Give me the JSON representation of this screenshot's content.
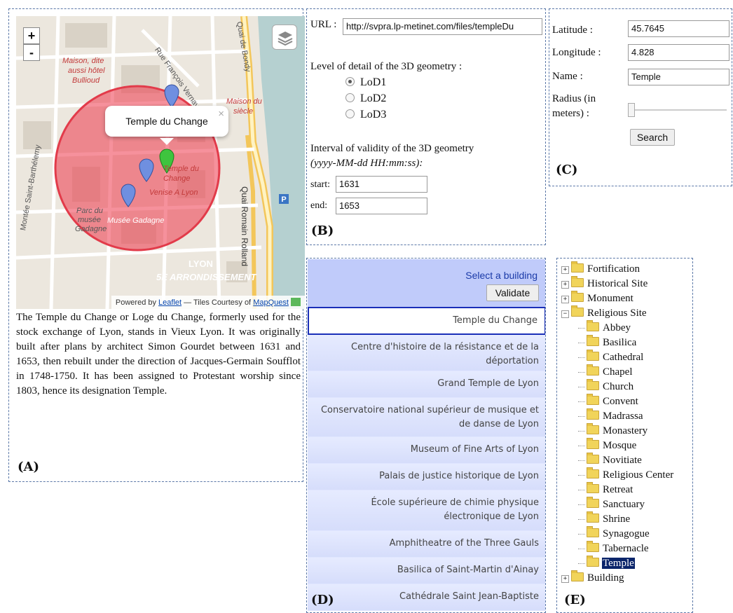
{
  "panelA": {
    "label": "(A)",
    "map": {
      "zoom_in": "+",
      "zoom_out": "-",
      "popup_text": "Temple du Change",
      "popup_close": "×",
      "attribution_prefix": "Powered by",
      "attribution_leaflet": "Leaflet",
      "attribution_mid": "— Tiles Courtesy of",
      "attribution_mapquest": "MapQuest",
      "street_labels": [
        "Maison, dite",
        "aussi hôtel",
        "Bullioud",
        "Rue François Vernay",
        "Quai de Bondy",
        "Maison du",
        "siècle",
        "Temple du",
        "Change",
        "Venise A Lyon",
        "Parc du",
        "musée",
        "Gadagne",
        "Musée Gadagne",
        "Quai Romain Rolland",
        "LYON",
        "5E ARRONDISSEMENT",
        "Montée Saint-Barthélemy",
        "P"
      ],
      "circle_color": "#e0505a",
      "marker_colors": [
        "#6f8fe0",
        "#3ec43e"
      ]
    },
    "description": "The Temple du Change or Loge du Change, formerly used for the stock exchange of Lyon, stands in Vieux Lyon. It was originally built after plans by architect Simon Gourdet between 1631 and 1653, then rebuilt under the direction of Jacques-Germain Soufflot in 1748-1750. It has been assigned to Protestant worship since 1803, hence its designation Temple."
  },
  "panelB": {
    "label": "(B)",
    "url_label": "URL :",
    "url_value": "http://svpra.lp-metinet.com/files/templeDu",
    "lod_label": "Level of detail of the 3D geometry :",
    "lod_options": [
      "LoD1",
      "LoD2",
      "LoD3"
    ],
    "lod_selected": "LoD1",
    "interval_label": "Interval of validity of the 3D geometry",
    "interval_format": "(yyyy-MM-dd HH:mm:ss):",
    "start_label": "start:",
    "start_value": "1631",
    "end_label": "end:",
    "end_value": "1653"
  },
  "panelC": {
    "label": "(C)",
    "latitude_label": "Latitude :",
    "latitude_value": "45.7645",
    "longitude_label": "Longitude :",
    "longitude_value": "4.828",
    "name_label": "Name :",
    "name_value": "Temple",
    "radius_label_1": "Radius (in",
    "radius_label_2": "meters) :",
    "radius_level": 0,
    "search_button": "Search"
  },
  "panelD": {
    "label": "(D)",
    "select_label": "Select a building",
    "validate_button": "Validate",
    "buildings": [
      "Temple du Change",
      "Centre d'histoire de la résistance et de la déportation",
      "Grand Temple de Lyon",
      "Conservatoire national supérieur de musique et de danse de Lyon",
      "Museum of Fine Arts of Lyon",
      "Palais de justice historique de Lyon",
      "École supérieure de chimie physique électronique de Lyon",
      "Amphitheatre of the Three Gauls",
      "Basilica of Saint-Martin d'Ainay",
      "Cathédrale Saint Jean-Baptiste"
    ],
    "selected_index": 0
  },
  "panelE": {
    "label": "(E)",
    "top_nodes": [
      {
        "label": "Fortification",
        "toggle": "+"
      },
      {
        "label": "Historical Site",
        "toggle": "+"
      },
      {
        "label": "Monument",
        "toggle": "+"
      },
      {
        "label": "Religious Site",
        "toggle": "-"
      }
    ],
    "religious_children": [
      "Abbey",
      "Basilica",
      "Cathedral",
      "Chapel",
      "Church",
      "Convent",
      "Madrassa",
      "Monastery",
      "Mosque",
      "Novitiate",
      "Religious Center",
      "Retreat",
      "Sanctuary",
      "Shrine",
      "Synagogue",
      "Tabernacle",
      "Temple"
    ],
    "selected_child": "Temple",
    "last_node": {
      "label": "Building",
      "toggle": "+"
    }
  }
}
